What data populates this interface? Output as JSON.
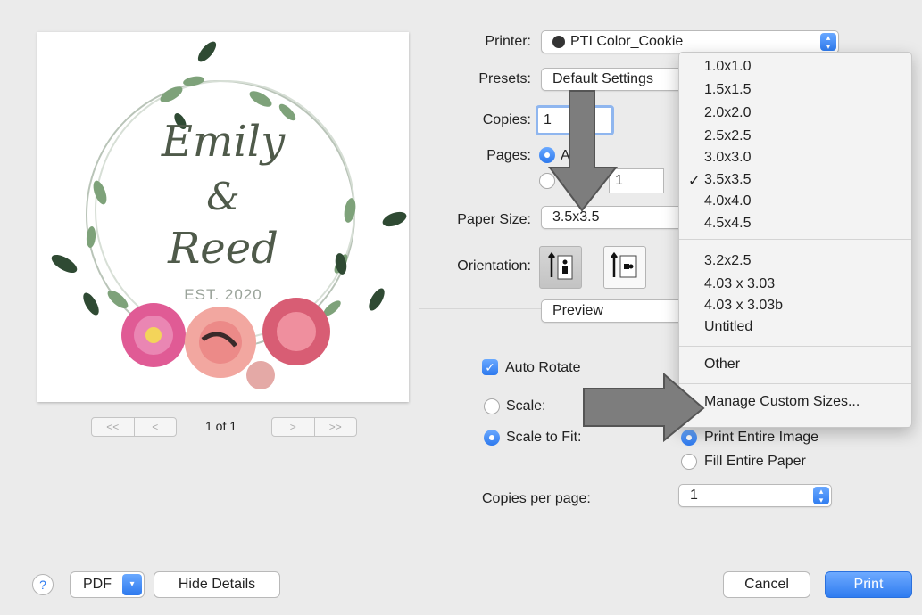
{
  "preview": {
    "names": [
      "Emily",
      "&",
      "Reed"
    ],
    "established": "EST. 2020",
    "page_indicator": "1 of 1",
    "first_label": "<<",
    "prev_label": "<",
    "next_label": ">",
    "last_label": ">>"
  },
  "printer": {
    "label": "Printer:",
    "value": "PTI Color_Cookie"
  },
  "presets": {
    "label": "Presets:",
    "value": "Default Settings"
  },
  "copies": {
    "label": "Copies:",
    "value": "1"
  },
  "pages": {
    "label": "Pages:",
    "all_visible": "A",
    "from_value": "1"
  },
  "paper_size": {
    "label": "Paper Size:",
    "value": "3.5x3.5",
    "menu_group1": [
      "1.0x1.0",
      "1.5x1.5",
      "2.0x2.0",
      "2.5x2.5",
      "3.0x3.0",
      "3.5x3.5",
      "4.0x4.0",
      "4.5x4.5"
    ],
    "selected_item": "3.5x3.5",
    "menu_group2": [
      "3.2x2.5",
      "4.03 x 3.03",
      "4.03 x 3.03b",
      "Untitled"
    ],
    "other": "Other",
    "manage": "Manage Custom Sizes...",
    "checkmark": "✓"
  },
  "orientation": {
    "label": "Orientation:"
  },
  "section": {
    "value": "Preview"
  },
  "auto_rotate": {
    "label": "Auto Rotate",
    "checked": true
  },
  "scale": {
    "label": "Scale:"
  },
  "scale_to_fit": {
    "label": "Scale to Fit:"
  },
  "fit_options": {
    "print_entire": "Print Entire Image",
    "fill_entire": "Fill Entire Paper"
  },
  "copies_per_page": {
    "label": "Copies per page:",
    "value": "1"
  },
  "footer": {
    "help": "?",
    "pdf": "PDF",
    "hide_details": "Hide Details",
    "cancel": "Cancel",
    "print": "Print"
  },
  "colors": {
    "accent": "#2f7cf0",
    "arrow": "#7d7d7d"
  }
}
